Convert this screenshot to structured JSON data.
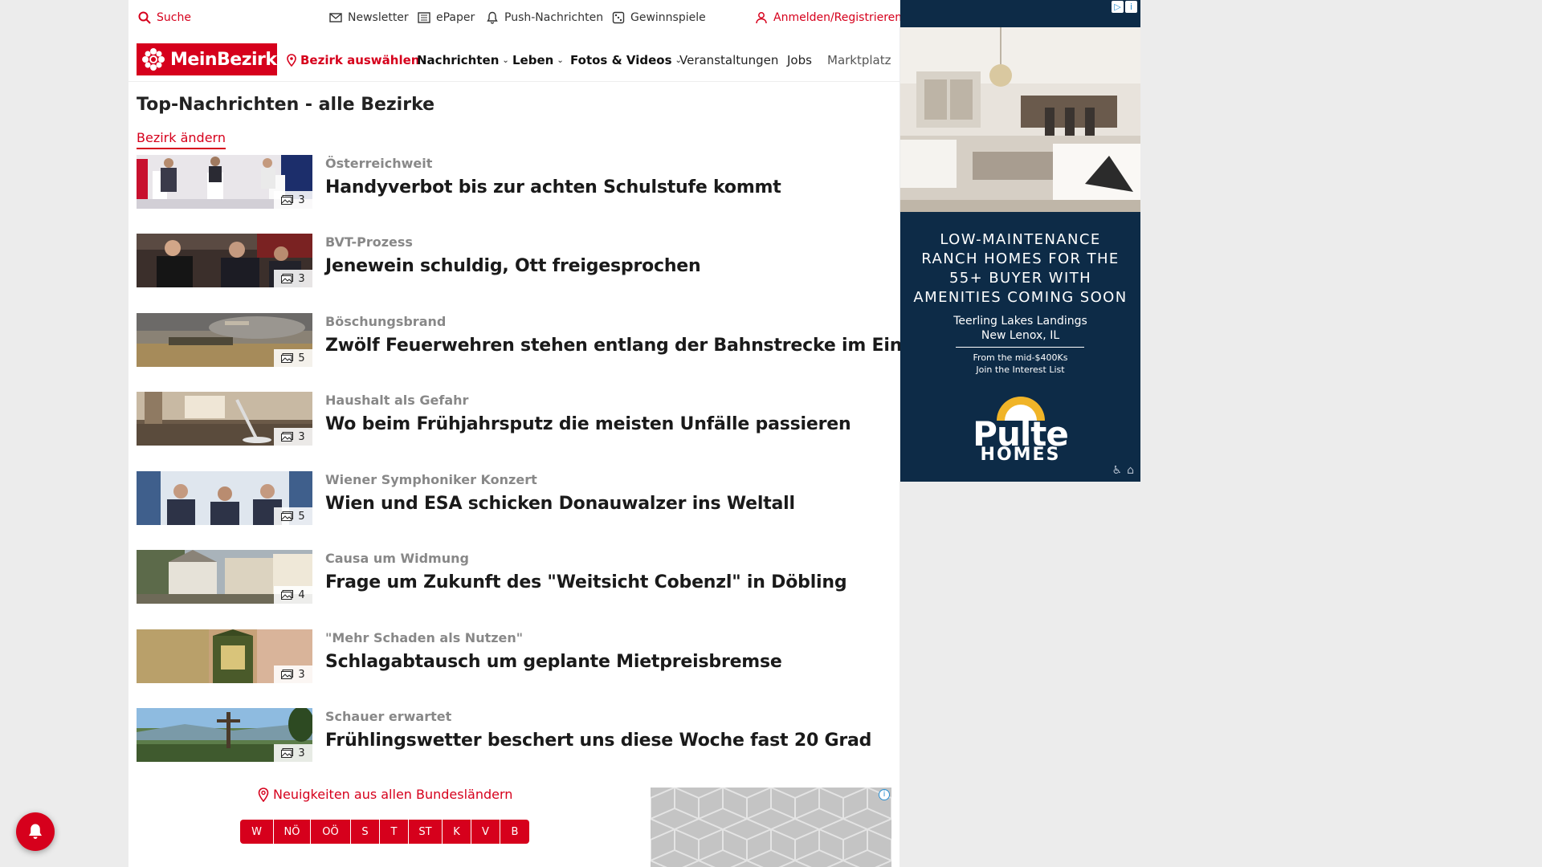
{
  "utility_bar": {
    "search_label": "Suche",
    "newsletter_label": "Newsletter",
    "epaper_label": "ePaper",
    "push_label": "Push-Nachrichten",
    "games_label": "Gewinnspiele",
    "login_label": "Anmelden/Registrieren"
  },
  "navbar": {
    "logo_text": "MeinBezirk",
    "select_district": "Bezirk auswählen",
    "items": [
      "Nachrichten",
      "Leben",
      "Fotos & Videos",
      "Veranstaltungen",
      "Jobs",
      "Marktplatz"
    ]
  },
  "main": {
    "title": "Top-Nachrichten - alle Bezirke",
    "change_district": "Bezirk ändern",
    "articles": [
      {
        "kicker": "Österreichweit",
        "headline": "Handyverbot bis zur achten Schulstufe kommt",
        "photos": "3"
      },
      {
        "kicker": "BVT-Prozess",
        "headline": "Jenewein schuldig, Ott freigesprochen",
        "photos": "3"
      },
      {
        "kicker": "Böschungsbrand",
        "headline": "Zwölf Feuerwehren stehen entlang der Bahnstrecke im Einsatz",
        "photos": "5"
      },
      {
        "kicker": "Haushalt als Gefahr",
        "headline": "Wo beim Frühjahrsputz die meisten Unfälle passieren",
        "photos": "3"
      },
      {
        "kicker": "Wiener Symphoniker Konzert",
        "headline": "Wien und ESA schicken Donauwalzer ins Weltall",
        "photos": "5"
      },
      {
        "kicker": "Causa um Widmung",
        "headline": "Frage um Zukunft des \"Weitsicht Cobenzl\" in Döbling",
        "photos": "4"
      },
      {
        "kicker": "\"Mehr Schaden als Nutzen\"",
        "headline": "Schlagabtausch um geplante Mietpreisbremse",
        "photos": "3"
      },
      {
        "kicker": "Schauer erwartet",
        "headline": "Frühlingswetter beschert uns diese Woche fast 20 Grad",
        "photos": "3"
      }
    ]
  },
  "bundeslaender": {
    "title": "Neuigkeiten aus allen Bundesländern",
    "states": [
      "W",
      "NÖ",
      "OÖ",
      "S",
      "T",
      "ST",
      "K",
      "V",
      "B"
    ]
  },
  "side_ad": {
    "headline_lines": [
      "LOW-MAINTENANCE",
      "RANCH HOMES FOR THE",
      "55+ BUYER WITH",
      "AMENITIES COMING SOON"
    ],
    "community": "Teerling Lakes Landings",
    "location": "New Lenox, IL",
    "price": "From the mid-$400Ks",
    "cta": "Join the Interest List",
    "brand_line1": "Pulte",
    "brand_line2": "HOMES"
  },
  "colors": {
    "brand_red": "#d6001c",
    "ad_navy": "#0d2b47"
  }
}
